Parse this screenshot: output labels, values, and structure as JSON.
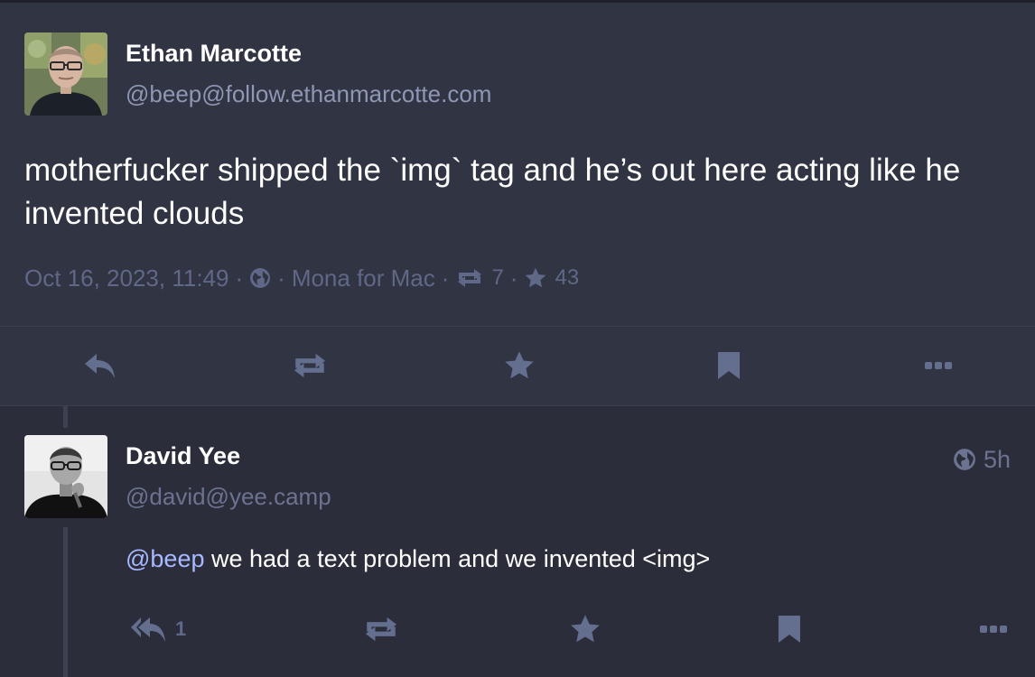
{
  "colors": {
    "background": "#2b2d3a",
    "focal_background": "#313443",
    "primary_text": "#ffffff",
    "secondary_text": "#8e97b3",
    "muted_text": "#5f6887",
    "mention": "#a7b9ff",
    "icon": "#646e8f"
  },
  "focal_post": {
    "display_name": "Ethan Marcotte",
    "handle": "@beep@follow.ethanmarcotte.com",
    "body": "motherfucker shipped the `img` tag and he’s out here acting like he invented clouds",
    "timestamp": "Oct 16, 2023, 11:49",
    "separator": "·",
    "visibility_icon": "globe-icon",
    "client": "Mona for Mac",
    "boost_count": "7",
    "favourite_count": "43",
    "actions": [
      {
        "icon": "reply-icon"
      },
      {
        "icon": "boost-icon"
      },
      {
        "icon": "star-icon"
      },
      {
        "icon": "bookmark-icon"
      },
      {
        "icon": "more-icon"
      }
    ]
  },
  "reply_post": {
    "display_name": "David Yee",
    "handle": "@david@yee.camp",
    "time": "5h",
    "visibility_icon": "globe-icon",
    "mention": "@beep",
    "body": " we had a text problem and we invented <img>",
    "reply_count": "1",
    "actions": [
      {
        "icon": "reply-all-icon"
      },
      {
        "icon": "boost-icon"
      },
      {
        "icon": "star-icon"
      },
      {
        "icon": "bookmark-icon"
      },
      {
        "icon": "more-icon"
      }
    ]
  }
}
